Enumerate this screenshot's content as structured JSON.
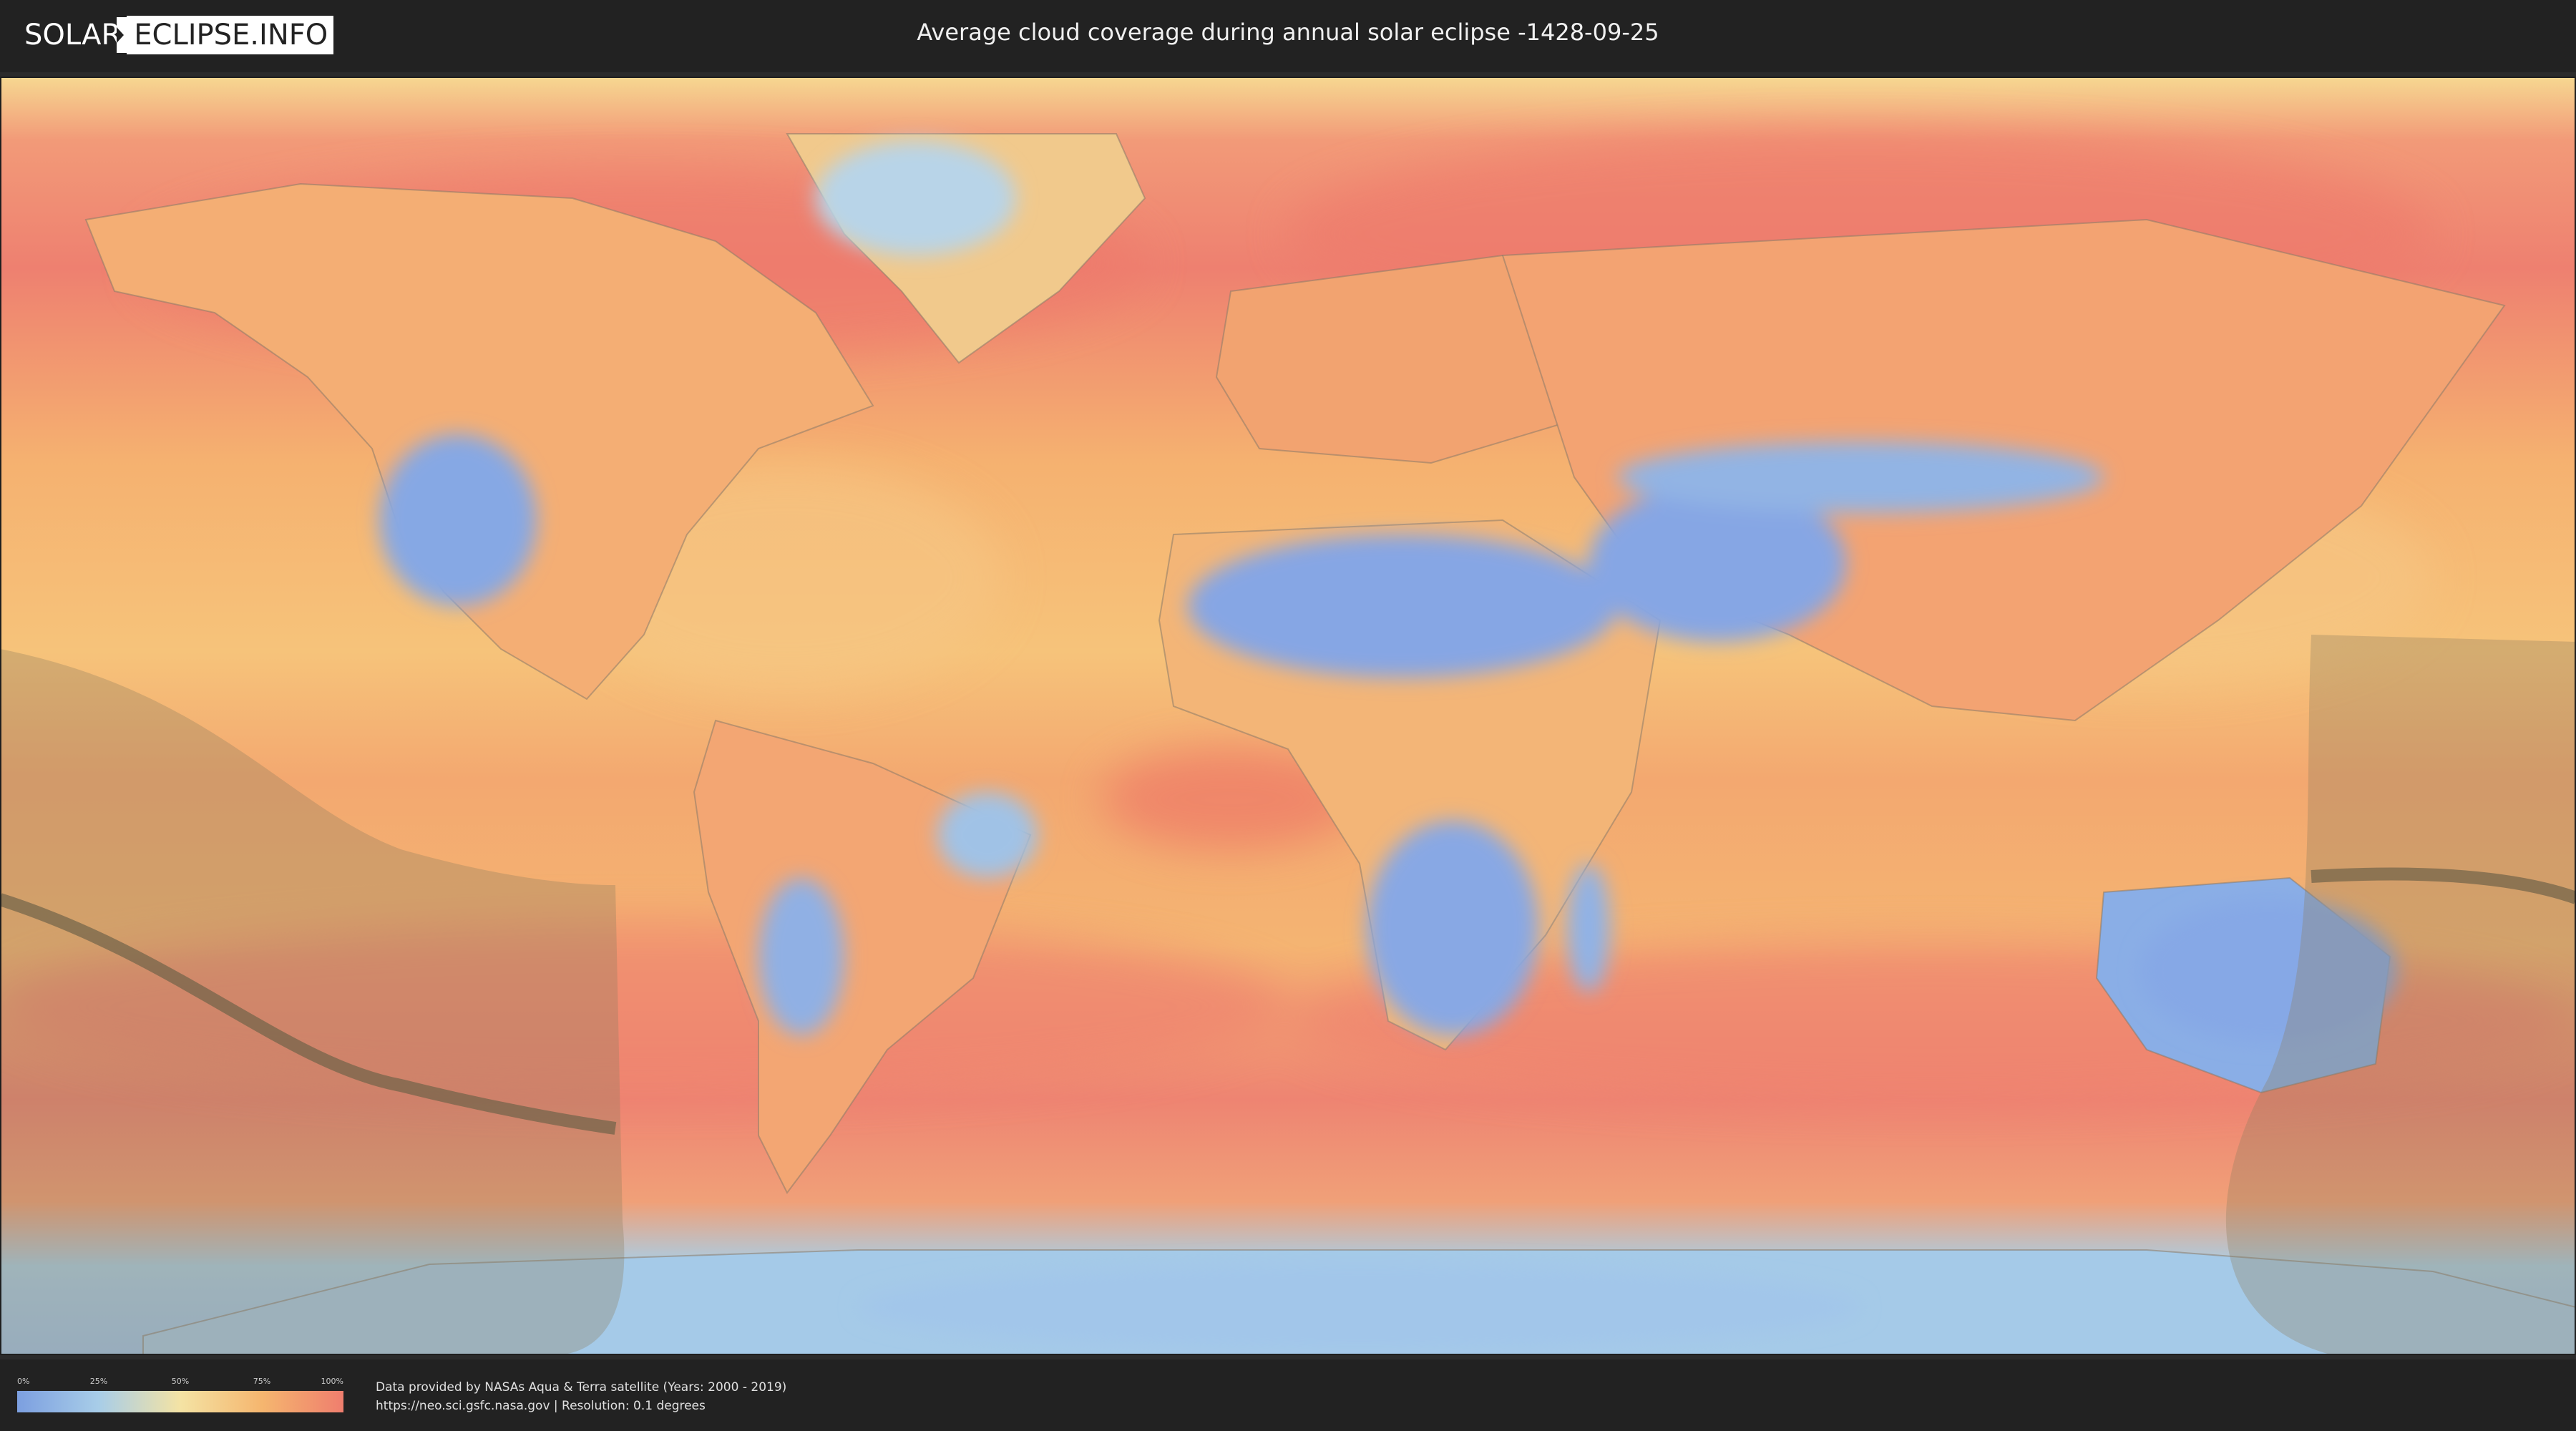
{
  "header": {
    "logo": {
      "part1": "SOLAR",
      "part2": "ECLIPSE.INFO"
    },
    "title": "Average cloud coverage during annual solar eclipse -1428-09-25"
  },
  "map": {
    "legend": {
      "ticks": [
        "0%",
        "25%",
        "50%",
        "75%",
        "100%"
      ],
      "colors": [
        "#7c9fe0",
        "#a8cde8",
        "#f4e3a4",
        "#f5b66f",
        "#ef7e6e"
      ]
    },
    "overlay_color": "#8c7c5c",
    "central_line_color": "#6f6248"
  },
  "footer": {
    "credit_line1": "Data provided by NASAs Aqua & Terra satellite (Years: 2000 - 2019)",
    "credit_line2": "https://neo.sci.gsfc.nasa.gov | Resolution: 0.1 degrees"
  }
}
